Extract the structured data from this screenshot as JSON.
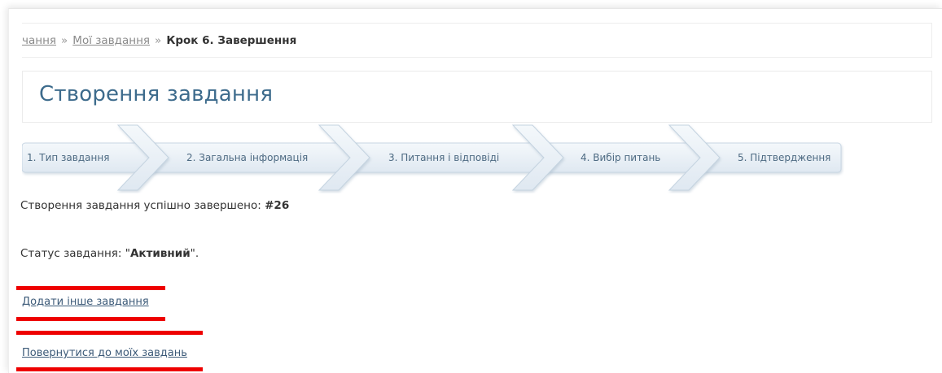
{
  "breadcrumb": {
    "items": [
      {
        "label": "чання"
      },
      {
        "label": "Мої завдання"
      }
    ],
    "separator": "»",
    "current": "Крок 6. Завершення"
  },
  "page_title": "Створення завдання",
  "steps": [
    {
      "label": "1. Тип завдання"
    },
    {
      "label": "2. Загальна інформація"
    },
    {
      "label": "3. Питання і відповіді"
    },
    {
      "label": "4. Вибір питань"
    },
    {
      "label": "5. Підтвердження"
    }
  ],
  "result": {
    "message_prefix": "Створення завдання успішно завершено:",
    "task_number": "#26",
    "status_prefix": "Статус завдання: \"",
    "status_value": "Активний",
    "status_suffix": "\"."
  },
  "links": {
    "add_another": "Додати інше завдання",
    "back_to_my": "Повернутися до моїх завдань"
  },
  "colors": {
    "accent": "#3d6b8c",
    "link": "#3c5a78",
    "highlight": "#ee0000",
    "step_fill": "#e6eef6",
    "step_border": "#c4d3e0"
  }
}
